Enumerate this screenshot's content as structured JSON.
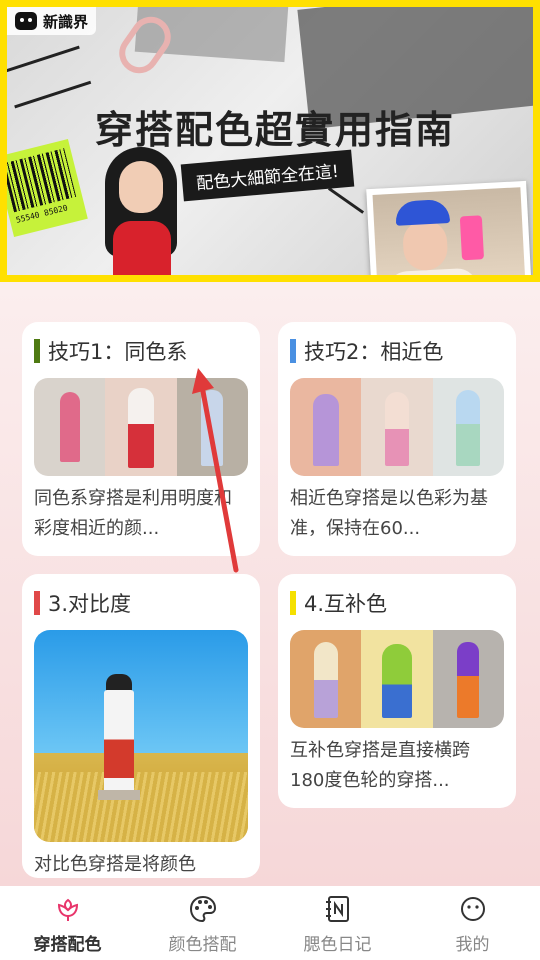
{
  "banner": {
    "logo_text": "新識界",
    "title": "穿搭配色超實用指南",
    "subtitle": "配色大細節全在這!",
    "barcode_number": "55540 85020"
  },
  "cards": [
    {
      "title": "技巧1：同色系",
      "bar_color": "#4e7a12",
      "description": "同色系穿搭是利用明度和彩度相近的颜..."
    },
    {
      "title": "技巧2：相近色",
      "bar_color": "#4a90e2",
      "description": "相近色穿搭是以色彩为基准，保持在60..."
    },
    {
      "title": "3.对比度",
      "bar_color": "#e04848",
      "description": "对比色穿搭是将颜色"
    },
    {
      "title": "4.互补色",
      "bar_color": "#f5e000",
      "description": "互补色穿搭是直接横跨180度色轮的穿搭..."
    }
  ],
  "tabs": [
    {
      "label": "穿搭配色",
      "icon": "flower-icon",
      "active": true
    },
    {
      "label": "颜色搭配",
      "icon": "palette-icon",
      "active": false
    },
    {
      "label": "腮色日记",
      "icon": "notebook-icon",
      "active": false
    },
    {
      "label": "我的",
      "icon": "smile-face-icon",
      "active": false
    }
  ],
  "colors": {
    "accent": "#e8356b",
    "highlight_frame": "#ffe000",
    "arrow": "#e03a3a"
  }
}
